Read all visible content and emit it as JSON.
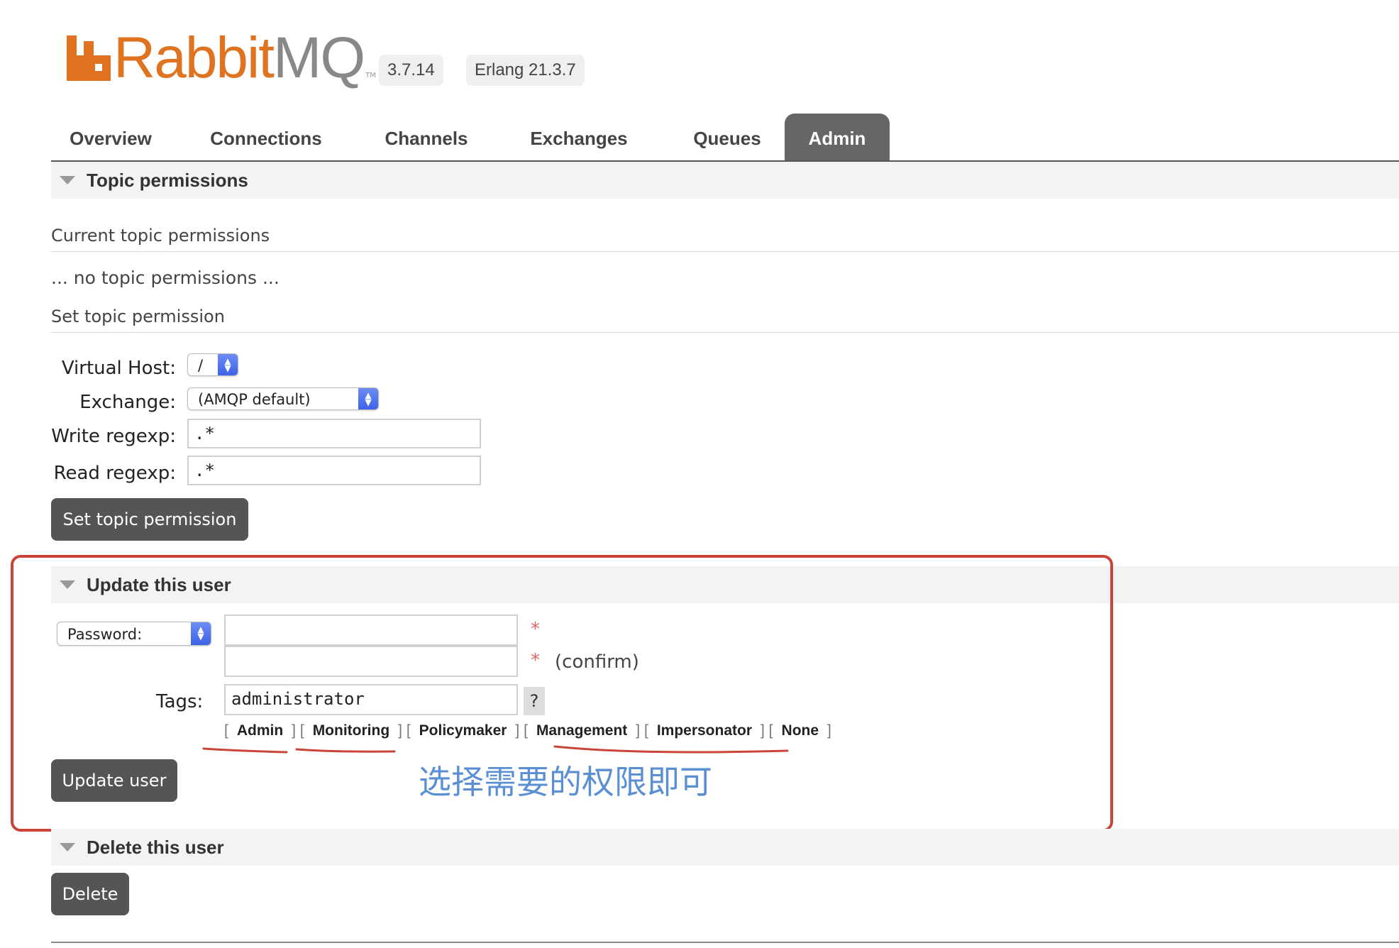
{
  "header": {
    "logo_prefix": "Rabbit",
    "logo_suffix": "MQ",
    "logo_tm": "TM",
    "version": "3.7.14",
    "erlang": "Erlang 21.3.7"
  },
  "tabs": [
    {
      "label": "Overview"
    },
    {
      "label": "Connections"
    },
    {
      "label": "Channels"
    },
    {
      "label": "Exchanges"
    },
    {
      "label": "Queues"
    },
    {
      "label": "Admin",
      "active": true
    }
  ],
  "topic_permissions": {
    "title": "Topic permissions",
    "current_heading": "Current topic permissions",
    "empty_text": "... no topic permissions ...",
    "set_heading": "Set topic permission",
    "virtual_host": {
      "label": "Virtual Host:",
      "value": "/"
    },
    "exchange": {
      "label": "Exchange:",
      "value": "(AMQP default)"
    },
    "write_regexp": {
      "label": "Write regexp:",
      "value": ".*"
    },
    "read_regexp": {
      "label": "Read regexp:",
      "value": ".*"
    },
    "submit_label": "Set topic permission"
  },
  "update_user": {
    "title": "Update this user",
    "password_select": "Password:",
    "required_mark": "*",
    "confirm_label": "(confirm)",
    "tags_label": "Tags:",
    "tags_value": "administrator",
    "help_label": "?",
    "tag_links": [
      "Admin",
      "Monitoring",
      "Policymaker",
      "Management",
      "Impersonator",
      "None"
    ],
    "submit_label": "Update user"
  },
  "delete_user": {
    "title": "Delete this user",
    "submit_label": "Delete"
  },
  "annotation": {
    "note": "选择需要的权限即可",
    "box_color": "#c9453a",
    "note_color": "#5a8fd3"
  },
  "colors": {
    "brand_orange": "#e0731f",
    "active_tab": "#666666",
    "button": "#555555"
  }
}
